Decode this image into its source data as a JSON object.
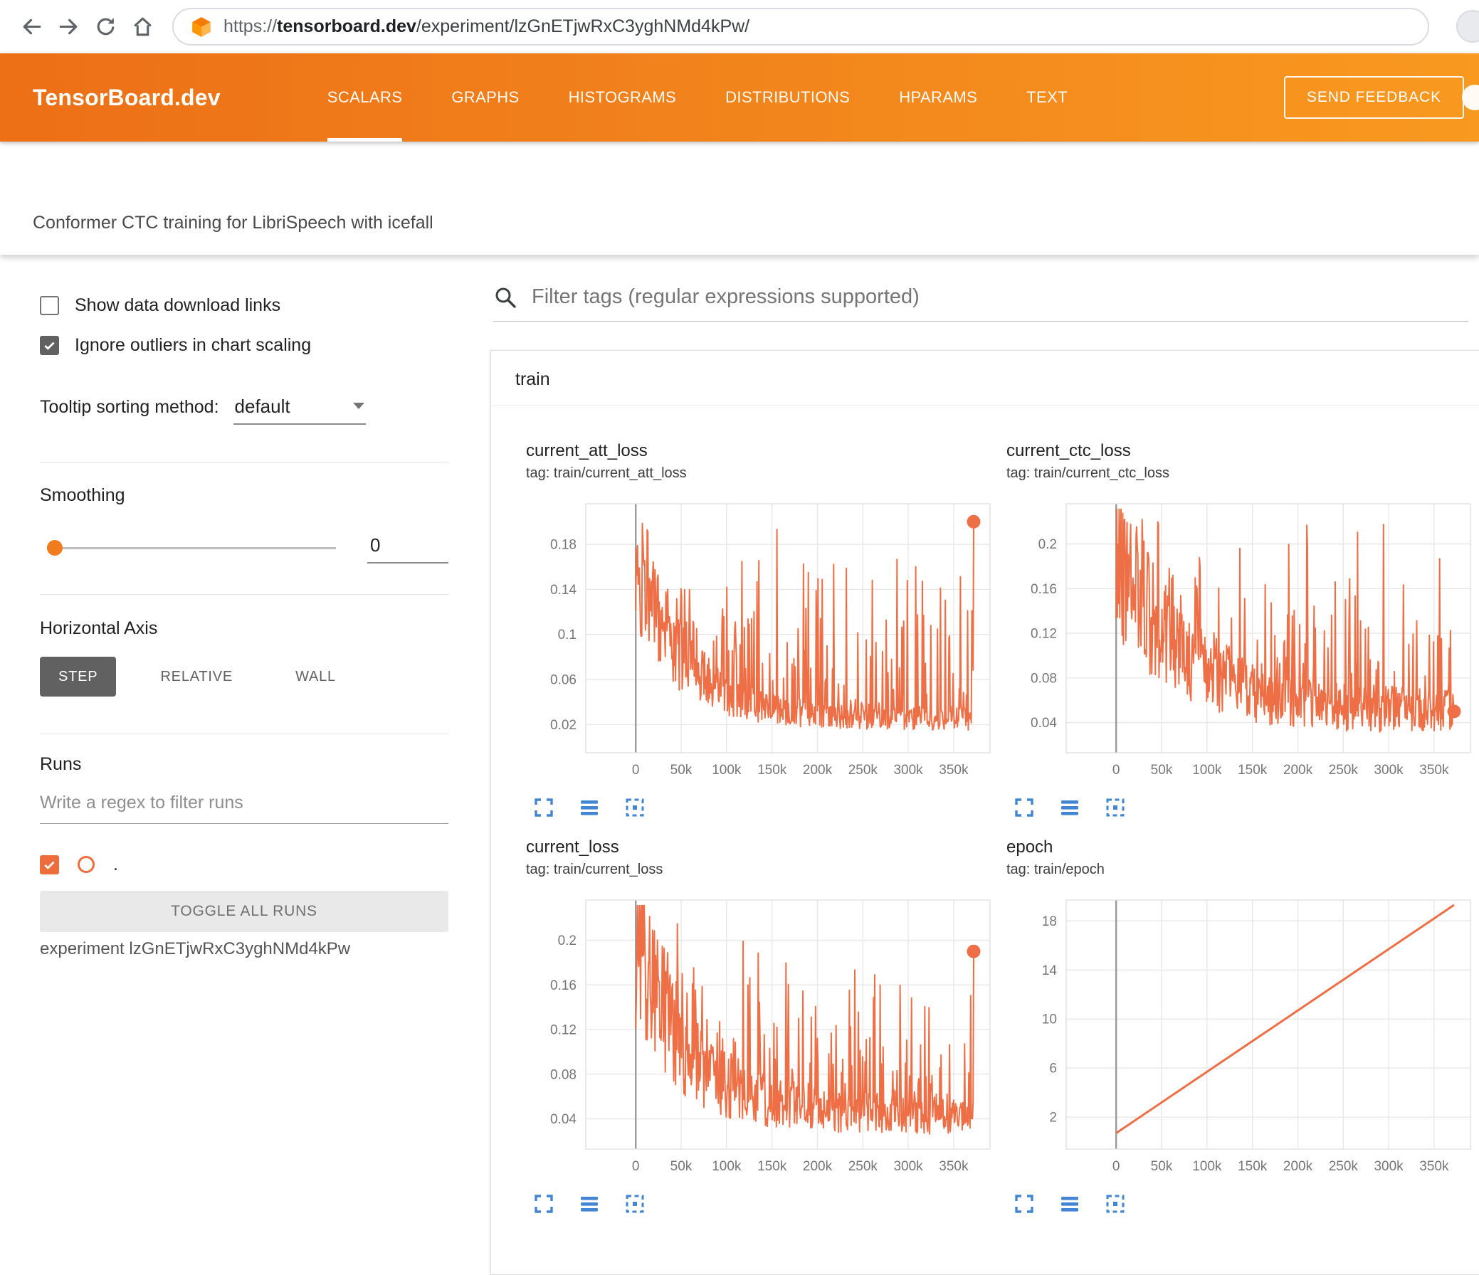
{
  "browser": {
    "url": {
      "scheme": "https://",
      "domain": "tensorboard.dev",
      "path": "/experiment/lzGnETjwRxC3yghNMd4kPw/"
    },
    "icons": [
      "back-icon",
      "forward-icon",
      "reload-icon",
      "home-icon",
      "tensorboard-favicon",
      "profile-avatar"
    ]
  },
  "header": {
    "brand": "TensorBoard.dev",
    "tabs": [
      {
        "label": "SCALARS",
        "active": true
      },
      {
        "label": "GRAPHS",
        "active": false
      },
      {
        "label": "HISTOGRAMS",
        "active": false
      },
      {
        "label": "DISTRIBUTIONS",
        "active": false
      },
      {
        "label": "HPARAMS",
        "active": false
      },
      {
        "label": "TEXT",
        "active": false
      }
    ],
    "feedback_button": "SEND FEEDBACK"
  },
  "experiment_title": "Conformer CTC training for LibriSpeech with icefall",
  "sidebar": {
    "show_download": {
      "label": "Show data download links",
      "checked": false
    },
    "ignore_outliers": {
      "label": "Ignore outliers in chart scaling",
      "checked": true
    },
    "tooltip_sorting": {
      "label": "Tooltip sorting method:",
      "value": "default"
    },
    "smoothing": {
      "label": "Smoothing",
      "value": "0"
    },
    "horizontal_axis": {
      "label": "Horizontal Axis",
      "options": [
        "STEP",
        "RELATIVE",
        "WALL"
      ],
      "selected": "STEP"
    },
    "runs": {
      "label": "Runs",
      "filter_placeholder": "Write a regex to filter runs",
      "run_name": ".",
      "run_checked": true,
      "toggle_button": "TOGGLE ALL RUNS",
      "experiment_label": "experiment lzGnETjwRxC3yghNMd4kPw"
    }
  },
  "main": {
    "filter_placeholder": "Filter tags (regular expressions supported)",
    "group_label": "train"
  },
  "colors": {
    "header_gradient": [
      "#ed6f16",
      "#f9991f"
    ],
    "series_orange": "#ee6f45",
    "slider_orange": "#f07c1e",
    "run_orange": "#ee6d3d",
    "chart_tool_blue": "#4285d2",
    "step_button_gray": "#616161"
  },
  "chart_data": [
    {
      "type": "line",
      "title": "current_att_loss",
      "tag": "tag: train/current_att_loss",
      "x_ticks": [
        "0",
        "50k",
        "100k",
        "150k",
        "200k",
        "250k",
        "300k",
        "350k"
      ],
      "x_tick_values": [
        0,
        50000,
        100000,
        150000,
        200000,
        250000,
        300000,
        350000
      ],
      "x_range": [
        -55000,
        390000
      ],
      "y_ticks": [
        "0.02",
        "0.06",
        "0.1",
        "0.14",
        "0.18"
      ],
      "y_tick_values": [
        0.02,
        0.06,
        0.1,
        0.14,
        0.18
      ],
      "y_range": [
        -0.005,
        0.216
      ],
      "series_color": "#ee6f45",
      "summary": "Very noisy attention loss: starts near 0.16-0.21, drops to a ~0.025 floor by step ~120k, persistent spikes up to 0.2 across all 370k steps, final marked point ~0.20 at step ~370k",
      "gen": {
        "kind": "noisy",
        "seed": 101,
        "n": 560,
        "x_max": 372000,
        "start": 0.165,
        "end": 0.024,
        "decay": 7,
        "spike_prob": 0.38,
        "spike_max": 0.215,
        "clip_top": 0.211,
        "clip_bottom": 0.012,
        "end_value": 0.2
      }
    },
    {
      "type": "line",
      "title": "current_ctc_loss",
      "tag": "tag: train/current_ctc_loss",
      "x_ticks": [
        "0",
        "50k",
        "100k",
        "150k",
        "200k",
        "250k",
        "300k",
        "350k"
      ],
      "x_tick_values": [
        0,
        50000,
        100000,
        150000,
        200000,
        250000,
        300000,
        350000
      ],
      "x_range": [
        -55000,
        390000
      ],
      "y_ticks": [
        "0.04",
        "0.08",
        "0.12",
        "0.16",
        "0.2"
      ],
      "y_tick_values": [
        0.04,
        0.08,
        0.12,
        0.16,
        0.2
      ],
      "y_range": [
        0.013,
        0.236
      ],
      "series_color": "#ee6f45",
      "summary": "Noisy CTC loss: starts near 0.18-0.23, slowly decays to ~0.05 floor, frequent spikes to 0.12-0.2 throughout, final marked point ~0.05 at step ~370k",
      "gen": {
        "kind": "noisy",
        "seed": 207,
        "n": 560,
        "x_max": 372000,
        "start": 0.185,
        "end": 0.047,
        "decay": 5,
        "spike_prob": 0.34,
        "spike_max": 0.235,
        "clip_top": 0.231,
        "clip_bottom": 0.03,
        "end_value": 0.05
      }
    },
    {
      "type": "line",
      "title": "current_loss",
      "tag": "tag: train/current_loss",
      "x_ticks": [
        "0",
        "50k",
        "100k",
        "150k",
        "200k",
        "250k",
        "300k",
        "350k"
      ],
      "x_tick_values": [
        0,
        50000,
        100000,
        150000,
        200000,
        250000,
        300000,
        350000
      ],
      "x_range": [
        -55000,
        390000
      ],
      "y_ticks": [
        "0.04",
        "0.08",
        "0.12",
        "0.16",
        "0.2"
      ],
      "y_tick_values": [
        0.04,
        0.08,
        0.12,
        0.16,
        0.2
      ],
      "y_range": [
        0.013,
        0.236
      ],
      "series_color": "#ee6f45",
      "summary": "Noisy total loss: starts near 0.19-0.23, decays to ~0.04 floor by ~150k, spikes up to 0.2 persist, final marked point ~0.19 at step ~370k",
      "gen": {
        "kind": "noisy",
        "seed": 313,
        "n": 560,
        "x_max": 372000,
        "start": 0.185,
        "end": 0.042,
        "decay": 6.5,
        "spike_prob": 0.36,
        "spike_max": 0.235,
        "clip_top": 0.231,
        "clip_bottom": 0.026,
        "end_value": 0.19
      }
    },
    {
      "type": "line",
      "title": "epoch",
      "tag": "tag: train/epoch",
      "x_ticks": [
        "0",
        "50k",
        "100k",
        "150k",
        "200k",
        "250k",
        "300k",
        "350k"
      ],
      "x_tick_values": [
        0,
        50000,
        100000,
        150000,
        200000,
        250000,
        300000,
        350000
      ],
      "x_range": [
        -55000,
        390000
      ],
      "y_ticks": [
        "2",
        "6",
        "10",
        "14",
        "18"
      ],
      "y_tick_values": [
        2,
        6,
        10,
        14,
        18
      ],
      "y_range": [
        -0.6,
        19.7
      ],
      "series_color": "#ee6f45",
      "summary": "Straight linear ramp: epoch rises from ~0.7 at step 0 to ~19.3 at step ~370k",
      "points": [
        [
          0,
          0.7
        ],
        [
          372000,
          19.3
        ]
      ],
      "gen": {
        "kind": "linear",
        "x_max": 372000,
        "y0": 0.7,
        "y1": 19.3
      }
    }
  ]
}
